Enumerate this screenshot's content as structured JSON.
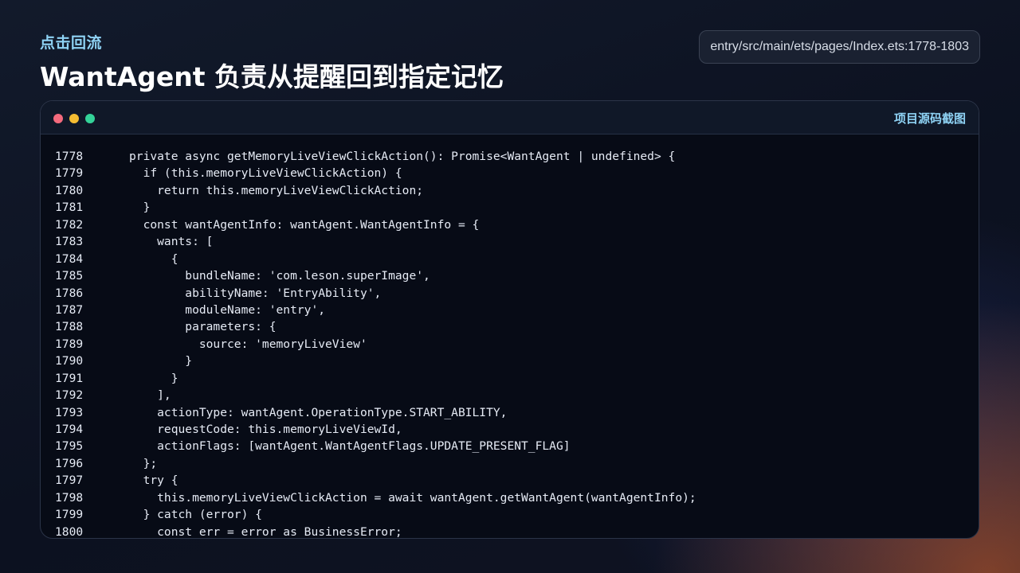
{
  "header": {
    "kicker": "点击回流",
    "title": "WantAgent 负责从提醒回到指定记忆",
    "file_path": "entry/src/main/ets/pages/Index.ets:1778-1803"
  },
  "window": {
    "label": "项目源码截图",
    "traffic_lights": [
      "#f46a7d",
      "#f5bd32",
      "#34d399"
    ]
  },
  "code": {
    "lines": [
      {
        "no": "1778",
        "text": "private async getMemoryLiveViewClickAction(): Promise<WantAgent | undefined> {"
      },
      {
        "no": "1779",
        "text": "  if (this.memoryLiveViewClickAction) {"
      },
      {
        "no": "1780",
        "text": "    return this.memoryLiveViewClickAction;"
      },
      {
        "no": "1781",
        "text": "  }"
      },
      {
        "no": "1782",
        "text": "  const wantAgentInfo: wantAgent.WantAgentInfo = {"
      },
      {
        "no": "1783",
        "text": "    wants: ["
      },
      {
        "no": "1784",
        "text": "      {"
      },
      {
        "no": "1785",
        "text": "        bundleName: 'com.leson.superImage',"
      },
      {
        "no": "1786",
        "text": "        abilityName: 'EntryAbility',"
      },
      {
        "no": "1787",
        "text": "        moduleName: 'entry',"
      },
      {
        "no": "1788",
        "text": "        parameters: {"
      },
      {
        "no": "1789",
        "text": "          source: 'memoryLiveView'"
      },
      {
        "no": "1790",
        "text": "        }"
      },
      {
        "no": "1791",
        "text": "      }"
      },
      {
        "no": "1792",
        "text": "    ],"
      },
      {
        "no": "1793",
        "text": "    actionType: wantAgent.OperationType.START_ABILITY,"
      },
      {
        "no": "1794",
        "text": "    requestCode: this.memoryLiveViewId,"
      },
      {
        "no": "1795",
        "text": "    actionFlags: [wantAgent.WantAgentFlags.UPDATE_PRESENT_FLAG]"
      },
      {
        "no": "1796",
        "text": "  };"
      },
      {
        "no": "1797",
        "text": "  try {"
      },
      {
        "no": "1798",
        "text": "    this.memoryLiveViewClickAction = await wantAgent.getWantAgent(wantAgentInfo);"
      },
      {
        "no": "1799",
        "text": "  } catch (error) {"
      },
      {
        "no": "1800",
        "text": "    const err = error as BusinessError;"
      }
    ]
  }
}
